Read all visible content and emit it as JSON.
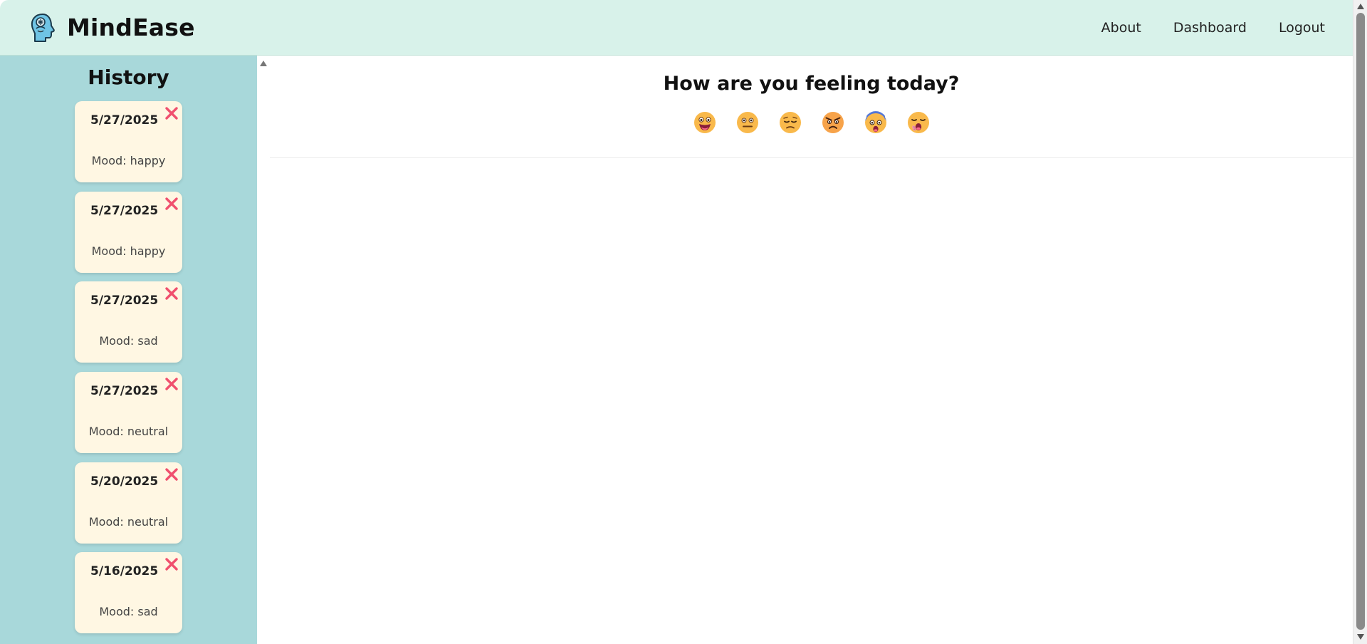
{
  "app": {
    "name": "MindEase"
  },
  "nav": {
    "links": [
      {
        "label": "About"
      },
      {
        "label": "Dashboard"
      },
      {
        "label": "Logout"
      }
    ]
  },
  "sidebar": {
    "title": "History",
    "entries": [
      {
        "date": "5/27/2025",
        "mood": "Mood: happy"
      },
      {
        "date": "5/27/2025",
        "mood": "Mood: happy"
      },
      {
        "date": "5/27/2025",
        "mood": "Mood: sad"
      },
      {
        "date": "5/27/2025",
        "mood": "Mood: neutral"
      },
      {
        "date": "5/20/2025",
        "mood": "Mood: neutral"
      },
      {
        "date": "5/16/2025",
        "mood": "Mood: sad"
      }
    ]
  },
  "main": {
    "question": "How are you feeling today?",
    "moods": [
      {
        "icon": "happy-emoji-icon"
      },
      {
        "icon": "neutral-emoji-icon"
      },
      {
        "icon": "sad-emoji-icon"
      },
      {
        "icon": "angry-emoji-icon"
      },
      {
        "icon": "anxious-emoji-icon"
      },
      {
        "icon": "tired-emoji-icon"
      }
    ]
  },
  "colors": {
    "navbar_bg": "#d8f2ea",
    "sidebar_bg": "#a8d8da",
    "card_bg": "#fff7e3",
    "delete_red": "#f0506e"
  }
}
